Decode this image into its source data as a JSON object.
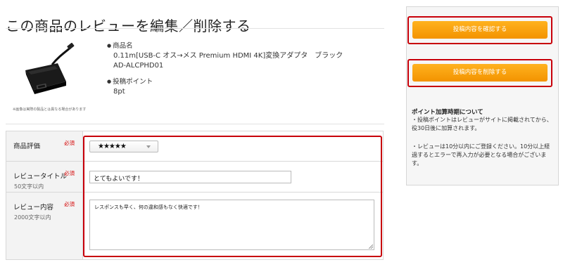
{
  "page": {
    "title": "この商品のレビューを編集／削除する"
  },
  "product": {
    "image_note": "※画像は実際の製品とは異なる場合があります",
    "name_label": "商品名",
    "name_value": "0.11m[USB-C オス→メス Premium HDMI 4K]変換アダプタ　ブラック　AD-ALCPHD01",
    "points_label": "投稿ポイント",
    "points_value": "8pt"
  },
  "form": {
    "rating": {
      "label": "商品評価",
      "required": "必須",
      "selected": "★★★★★"
    },
    "review_title": {
      "label": "レビュータイトル",
      "sub": "50文字以内",
      "required": "必須",
      "value": "とてもよいです！"
    },
    "review_body": {
      "label": "レビュー内容",
      "sub": "2000文字以内",
      "required": "必須",
      "value": "レスポンスも早く、何の違和感もなく快適です！"
    }
  },
  "sidebar": {
    "confirm_button": "投稿内容を確認する",
    "delete_button": "投稿内容を削除する",
    "notice_title": "ポイント加算時期について",
    "notice_1": "・投稿ポイントはレビューがサイトに掲載されてから、役30日後に加算されます。",
    "notice_2": "・レビューは10分以内にご登録ください。10分以上経過するとエラーで再入力が必要となる場合がございます。"
  },
  "colors": {
    "accent": "#f7a20c",
    "highlight": "#c8000a",
    "required": "#d40000"
  }
}
